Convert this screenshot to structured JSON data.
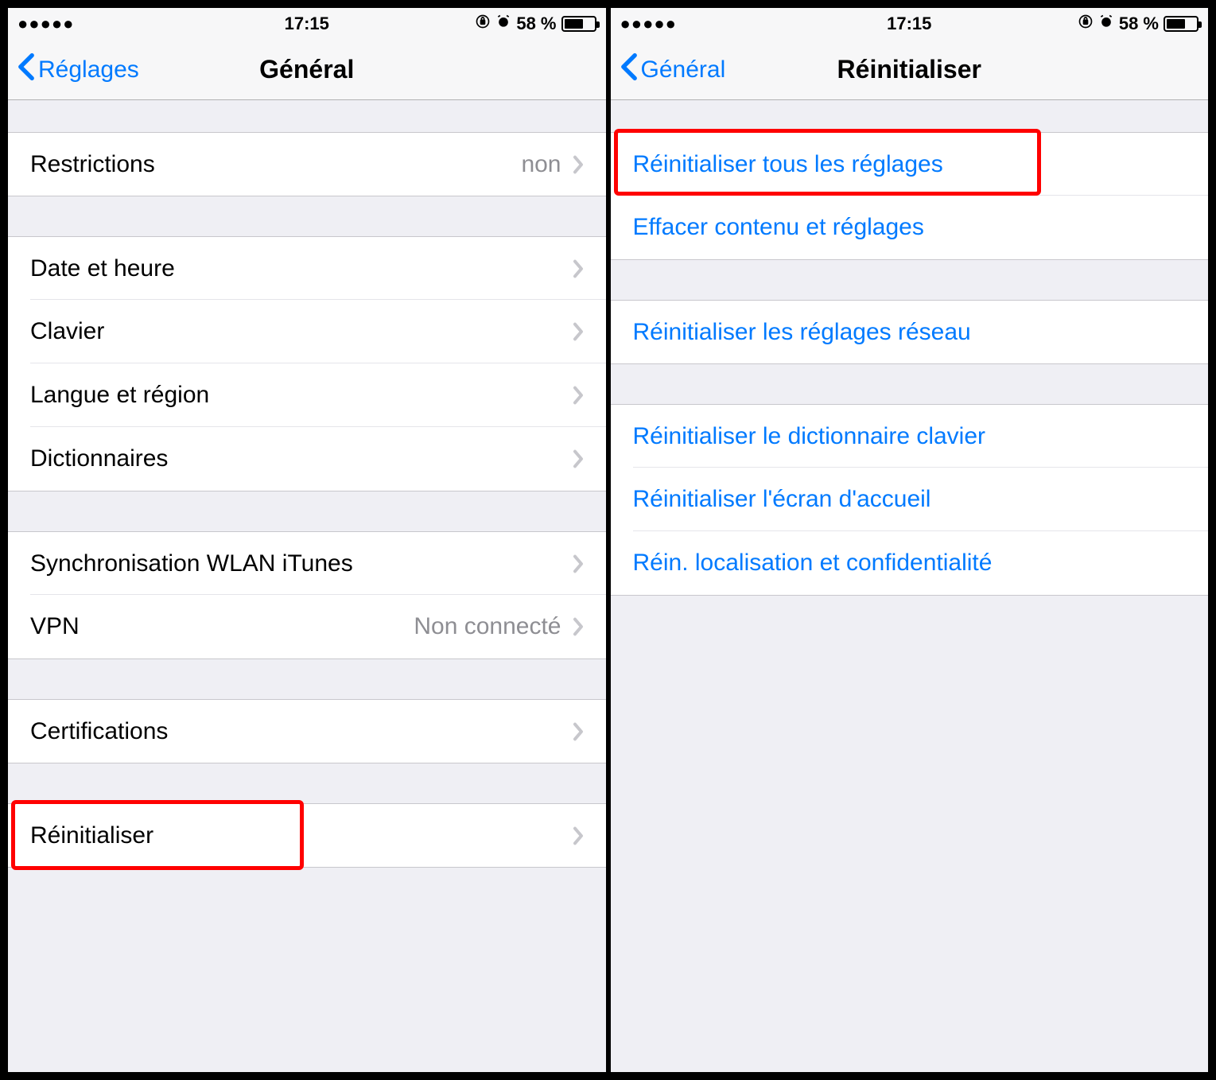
{
  "status": {
    "time": "17:15",
    "battery_pct": "58 %",
    "signal_dots": "●●●●●"
  },
  "left": {
    "back_label": "Réglages",
    "title": "Général",
    "groups": [
      {
        "items": [
          {
            "label": "Restrictions",
            "value": "non"
          }
        ]
      },
      {
        "items": [
          {
            "label": "Date et heure"
          },
          {
            "label": "Clavier"
          },
          {
            "label": "Langue et région"
          },
          {
            "label": "Dictionnaires"
          }
        ]
      },
      {
        "items": [
          {
            "label": "Synchronisation WLAN iTunes"
          },
          {
            "label": "VPN",
            "value": "Non connecté"
          }
        ]
      },
      {
        "items": [
          {
            "label": "Certifications"
          }
        ]
      },
      {
        "items": [
          {
            "label": "Réinitialiser",
            "highlight": true
          }
        ]
      }
    ]
  },
  "right": {
    "back_label": "Général",
    "title": "Réinitialiser",
    "groups": [
      {
        "items": [
          {
            "label": "Réinitialiser tous les réglages",
            "highlight": true
          },
          {
            "label": "Effacer contenu et réglages"
          }
        ]
      },
      {
        "items": [
          {
            "label": "Réinitialiser les réglages réseau"
          }
        ]
      },
      {
        "items": [
          {
            "label": "Réinitialiser le dictionnaire clavier"
          },
          {
            "label": "Réinitialiser l'écran d'accueil"
          },
          {
            "label": "Réin. localisation et confidentialité"
          }
        ]
      }
    ]
  }
}
